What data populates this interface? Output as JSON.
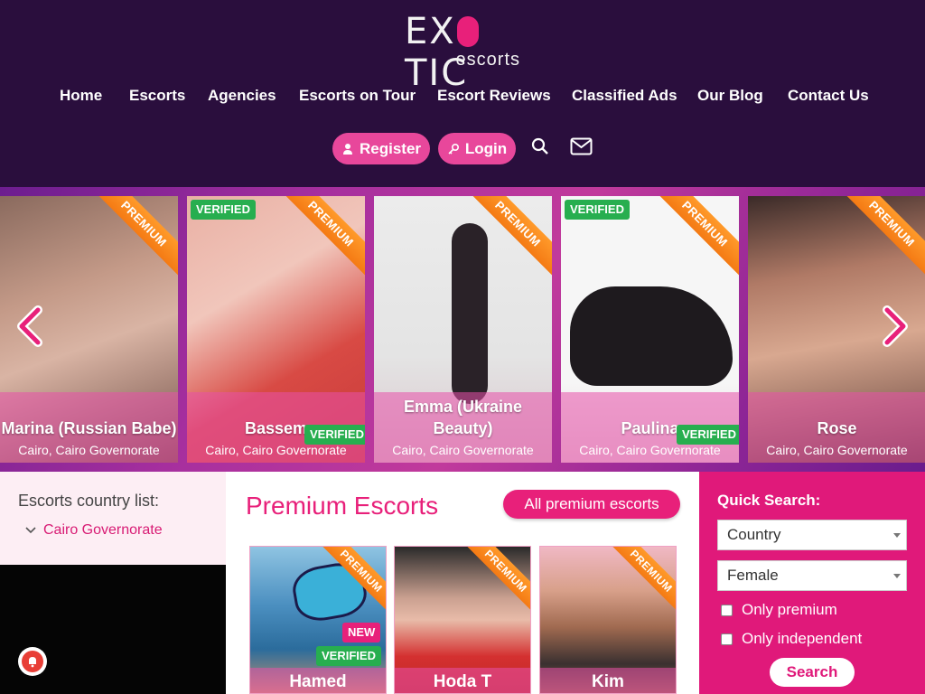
{
  "brand": {
    "logo_main_left": "EX",
    "logo_main_right": "TIC",
    "logo_sub": "escorts"
  },
  "nav": [
    "Home",
    "Escorts",
    "Agencies",
    "Escorts on Tour",
    "Escort Reviews",
    "Classified Ads",
    "Our Blog",
    "Contact Us"
  ],
  "auth": {
    "register": "Register",
    "login": "Login"
  },
  "icons": {
    "search": "search-icon",
    "mail": "mail-icon"
  },
  "carousel": {
    "cards": [
      {
        "name": "Marina (Russian Babe)",
        "location": "Cairo, Cairo Governorate",
        "premium": "PREMIUM",
        "verified_top": "",
        "verified_bottom": ""
      },
      {
        "name": "Bassem",
        "location": "Cairo, Cairo Governorate",
        "premium": "PREMIUM",
        "verified_top": "VERIFIED",
        "verified_bottom": "VERIFIED"
      },
      {
        "name": "Emma (Ukraine Beauty)",
        "location": "Cairo, Cairo Governorate",
        "premium": "PREMIUM",
        "verified_top": "",
        "verified_bottom": ""
      },
      {
        "name": "Paulina",
        "location": "Cairo, Cairo Governorate",
        "premium": "PREMIUM",
        "verified_top": "VERIFIED",
        "verified_bottom": "VERIFIED"
      },
      {
        "name": "Rose",
        "location": "Cairo, Cairo Governorate",
        "premium": "PREMIUM",
        "verified_top": "",
        "verified_bottom": ""
      }
    ]
  },
  "sidebar": {
    "title": "Escorts country list:",
    "items": [
      "Cairo Governorate"
    ]
  },
  "premium": {
    "title": "Premium Escorts",
    "all_button": "All premium escorts",
    "cards": [
      {
        "name": "Hamed",
        "ribbon": "PREMIUM",
        "badge_new": "NEW",
        "badge_verified": "VERIFIED"
      },
      {
        "name": "Hoda T",
        "ribbon": "PREMIUM"
      },
      {
        "name": "Kim",
        "ribbon": "PREMIUM"
      }
    ]
  },
  "quick_search": {
    "title": "Quick Search:",
    "country_value": "Country",
    "gender_value": "Female",
    "only_premium": "Only premium",
    "only_independent": "Only independent",
    "search_button": "Search"
  },
  "colors": {
    "header_bg": "#2a0e3d",
    "accent": "#e8207a",
    "premium_ribbon": "#f47a14",
    "verified": "#27ae4f"
  }
}
